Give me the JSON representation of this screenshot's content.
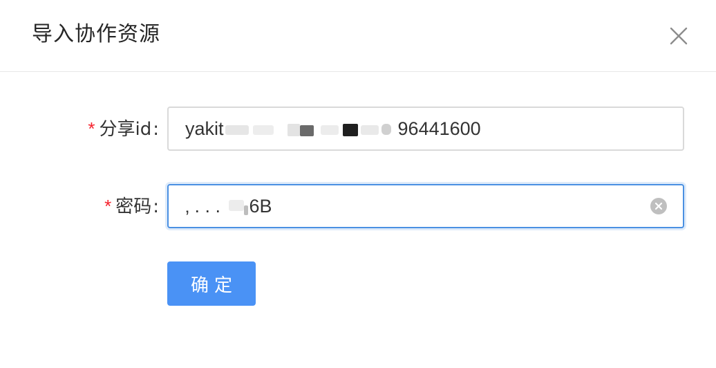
{
  "dialog": {
    "title": "导入协作资源",
    "close_icon": "close-icon"
  },
  "form": {
    "share_id": {
      "required_mark": "*",
      "label": "分享id",
      "colon": ":",
      "value_prefix": "yakit",
      "value_suffix": "96441600"
    },
    "password": {
      "required_mark": "*",
      "label": "密码",
      "colon": ":",
      "value_prefix": "‚ . . . ",
      "value_suffix": "6B",
      "clear_icon": "clear-circle-icon"
    },
    "submit_label": "确定"
  },
  "colors": {
    "required": "#f5222d",
    "primary": "#4a92f5",
    "focus_border": "#4a90e2"
  }
}
